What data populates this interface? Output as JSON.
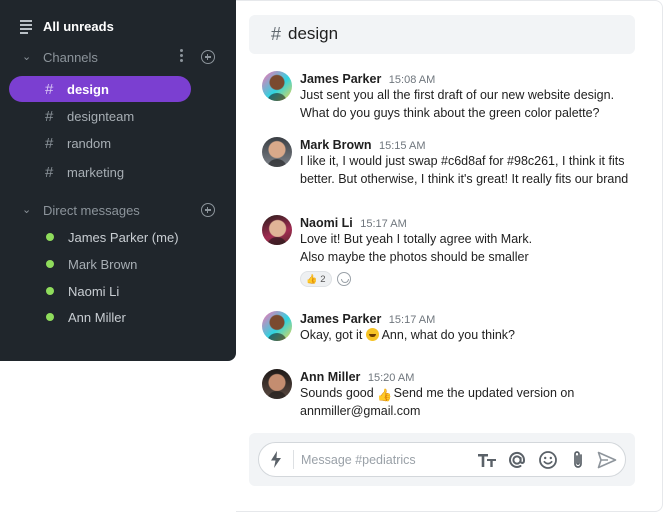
{
  "sidebar": {
    "all_unreads": "All unreads",
    "channels_heading": "Channels",
    "channels": [
      {
        "label": "design",
        "active": true
      },
      {
        "label": "designteam"
      },
      {
        "label": "random"
      },
      {
        "label": "marketing"
      }
    ],
    "dm_heading": "Direct messages",
    "direct_messages": [
      {
        "label": "James Parker (me)",
        "status": "online"
      },
      {
        "label": "Mark Brown",
        "status": "online"
      },
      {
        "label": "Naomi Li",
        "status": "online"
      },
      {
        "label": "Ann Miller",
        "status": "online"
      }
    ],
    "hash": "#"
  },
  "channel": {
    "hash": "#",
    "title": "design"
  },
  "messages": [
    {
      "author": "James Parker",
      "time": "15:08 AM",
      "lines": [
        "Just sent you all the first draft of our new website design.",
        "What do you guys think about the green color palette?"
      ]
    },
    {
      "author": "Mark Brown",
      "time": "15:15 AM",
      "lines": [
        "I like it, I would just swap #c6d8af for #98c261, I think it fits",
        "better. But otherwise, I think it's great! It really fits our brand"
      ]
    },
    {
      "author": "Naomi Li",
      "time": "15:17 AM",
      "lines": [
        "Love it! But yeah I totally agree with Mark.",
        "Also maybe the photos should be smaller"
      ],
      "reaction": {
        "emoji": "👍",
        "count": "2"
      }
    },
    {
      "author": "James Parker",
      "time": "15:17 AM",
      "line_before_emoji": "Okay, got it",
      "line_after_emoji": "Ann, what do you think?"
    },
    {
      "author": "Ann Miller",
      "time": "15:20 AM",
      "line_before_emoji": "Sounds good",
      "line_after_emoji": "Send me the updated version on",
      "line2": "annmiller@gmail.com"
    }
  ],
  "composer": {
    "placeholder": "Message #pediatrics",
    "value": ""
  },
  "colors": {
    "sidebar_bg": "#20262c",
    "accent": "#7b3fd1",
    "online": "#8fdc5c"
  },
  "icons": {
    "all_unreads": "list-lines-icon",
    "collapse": "chevron-down-icon",
    "more": "kebab-menu-icon",
    "add": "plus-circle-icon",
    "composer": [
      "bolt-icon",
      "text-format-icon",
      "mention-icon",
      "emoji-icon",
      "paperclip-icon",
      "send-icon"
    ]
  }
}
